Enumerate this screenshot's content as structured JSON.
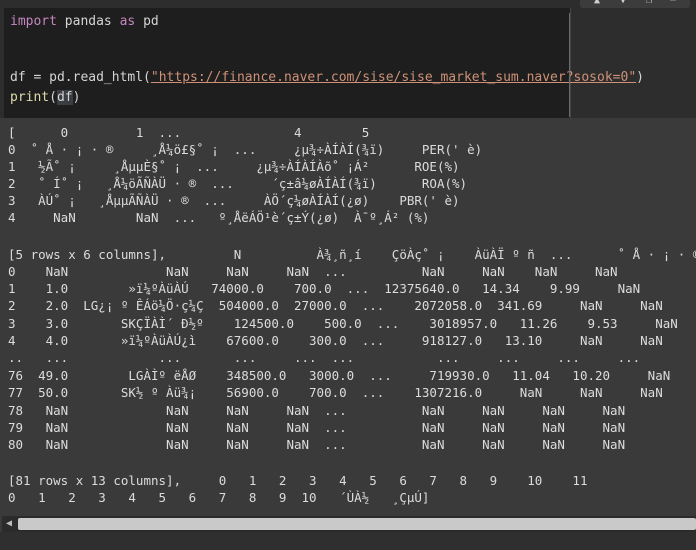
{
  "code": {
    "line1": {
      "kw1": "import",
      "mid": " pandas ",
      "kw2": "as",
      "end": " pd"
    },
    "line2": {
      "pre": "df = pd.read_html(",
      "url": "\"https://finance.naver.com/sise/sise_market_sum.naver?sosok=0\"",
      "post": ")"
    },
    "line3": {
      "fn": "print",
      "open": "(",
      "arg": "df",
      "close": ")"
    }
  },
  "output_lines": [
    "[      0         1  ...               4        5",
    "0  ˚ Å · ¡ · ®     ¸Å¼ö£§˚ ¡  ...     ¿µ¾÷ÀÍÀÍ(¾ï)     PER(' è)",
    "1   ½Ã˚ ¡     ¸ÅµµÈ§˚ ¡  ...     ¿µ¾÷ÀÍÀÍÀõ˚ ¡Á²      ROE(%)",
    "2   ˚ Í˚ ¡   ¸Å¼öÃÑÀÜ · ®  ...     ´ç±â¼øÀÍÀÍ(¾ï)      ROA(%)",
    "3   ÀÚ˚ ¡   ¸ÅµµÃÑÀÜ · ®  ...     ÀÖ´ç¼øÀÍÀÍ(¿ø)    PBR(' è)",
    "4     NaN        NaN  ...   º¸ÅëÁÖ¹è´ç±Ý(¿ø)  À¯º¸Á² (%)",
    "",
    "[5 rows x 6 columns],         N          À¾¸ñ¸í    ÇöÀç˚ ¡    ÀüÀÏ º ñ  ...      ˚ Å · ¡ · ®     ",
    "0    NaN             NaN     NaN     NaN  ...          NaN     NaN    NaN     NaN",
    "1    1.0        »ï¼ºÀüÀÚ   74000.0    700.0  ...  12375640.0   14.34    9.99     NaN",
    "2    2.0  LG¿¡ º ÊÁö¼Ö·ç¼Ç  504000.0  27000.0  ...    2072058.0  341.69     NaN     NaN",
    "3    3.0       SKÇÏÀÌ´ Ð½º    124500.0    500.0  ...    3018957.0   11.26    9.53     NaN",
    "4    4.0       »ï¼ºÀüÀÚ¿ì    67600.0    300.0  ...     918127.0   13.10     NaN     NaN",
    "..   ...            ...       ...     ...  ...           ...     ...     ...     ...",
    "76  49.0        LGÀÌº ëÅØ    348500.0   3000.0  ...     719930.0   11.04   10.20     NaN",
    "77  50.0       SK½ º Àü¾¡    56900.0    700.0  ...    1307216.0     NaN     NaN     NaN",
    "78   NaN             NaN     NaN     NaN  ...          NaN     NaN     NaN     NaN",
    "79   NaN             NaN     NaN     NaN  ...          NaN     NaN     NaN     NaN",
    "80   NaN             NaN     NaN     NaN  ...          NaN     NaN     NaN     NaN",
    "",
    "[81 rows x 13 columns],     0   1   2   3   4   5   6   7   8   9    10    11",
    "0   1   2   3   4   5   6   7   8   9  10   ´ÙÀ½   ¸ÇµÚ]"
  ]
}
